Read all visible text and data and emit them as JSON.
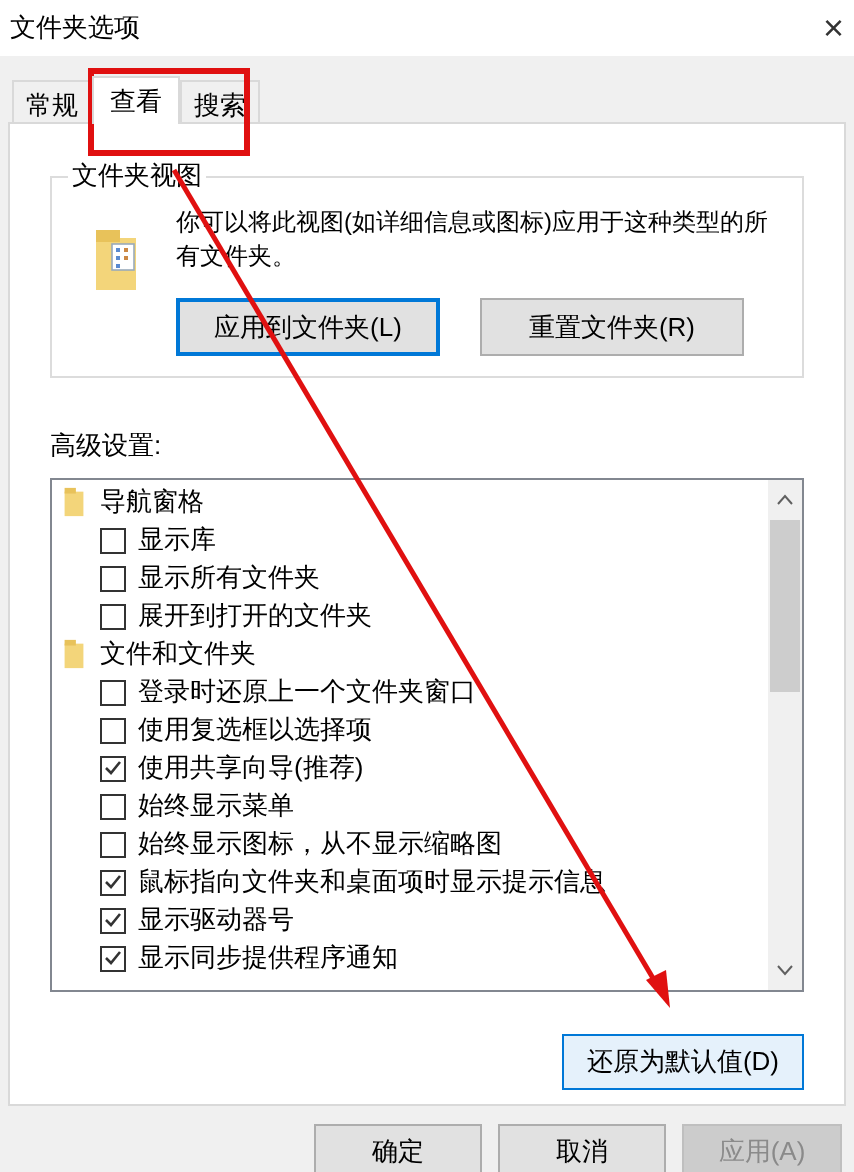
{
  "window": {
    "title": "文件夹选项",
    "close": "×"
  },
  "tabs": [
    {
      "label": "常规",
      "selected": false
    },
    {
      "label": "查看",
      "selected": true
    },
    {
      "label": "搜索",
      "selected": false
    }
  ],
  "folder_views": {
    "title": "文件夹视图",
    "description": "你可以将此视图(如详细信息或图标)应用于这种类型的所有文件夹。",
    "buttons": [
      {
        "label": "应用到文件夹(L)",
        "focused": true
      },
      {
        "label": "重置文件夹(R)",
        "focused": false
      }
    ]
  },
  "advanced": {
    "title": "高级设置:",
    "items": [
      {
        "label": "导航窗格",
        "children": [
          {
            "label": "显示库",
            "checked": false
          },
          {
            "label": "显示所有文件夹",
            "checked": false
          },
          {
            "label": "展开到打开的文件夹",
            "checked": false
          }
        ]
      },
      {
        "label": "文件和文件夹",
        "children": [
          {
            "label": "登录时还原上一个文件夹窗口",
            "checked": false
          },
          {
            "label": "使用复选框以选择项",
            "checked": false
          },
          {
            "label": "使用共享向导(推荐)",
            "checked": true
          },
          {
            "label": "始终显示菜单",
            "checked": false
          },
          {
            "label": "始终显示图标，从不显示缩略图",
            "checked": false
          },
          {
            "label": "鼠标指向文件夹和桌面项时显示提示信息",
            "checked": true
          },
          {
            "label": "显示驱动器号",
            "checked": true
          },
          {
            "label": "显示同步提供程序通知",
            "checked": true
          }
        ]
      }
    ],
    "restore_button": "还原为默认值(D)"
  },
  "footer_buttons": [
    {
      "label": "确定",
      "disabled": false
    },
    {
      "label": "取消",
      "disabled": false
    },
    {
      "label": "应用(A)",
      "disabled": true
    }
  ]
}
